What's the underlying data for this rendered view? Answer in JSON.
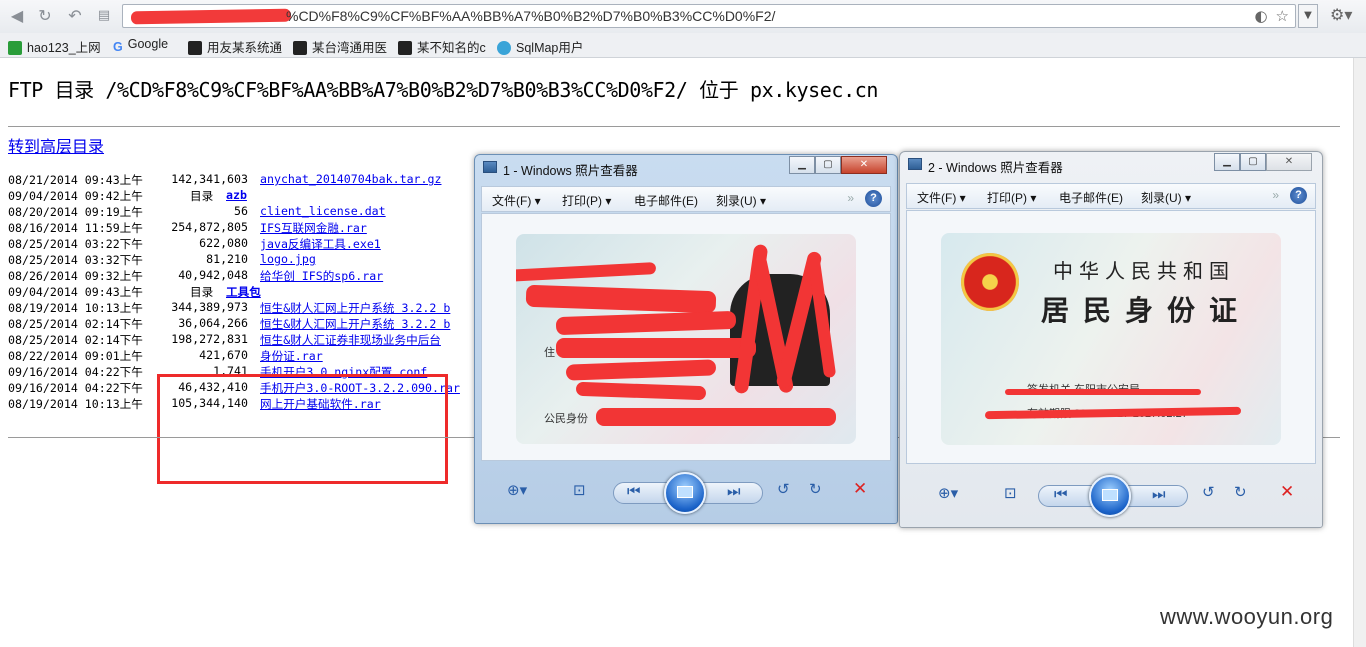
{
  "browser": {
    "address_tail": "%CD%F8%C9%CF%BF%AA%BB%A7%B0%B2%D7%B0%B3%CC%D0%F2/",
    "bookmarks": [
      {
        "label": "hao123_上网",
        "icon_color": "#2a9d3a"
      },
      {
        "label": "Google",
        "icon_color": "#4285f4"
      },
      {
        "label": "用友某系统通",
        "icon_color": "#222222"
      },
      {
        "label": "某台湾通用医",
        "icon_color": "#222222"
      },
      {
        "label": "某不知名的c",
        "icon_color": "#222222"
      },
      {
        "label": "SqlMap用户",
        "icon_color": "#3aa4d8"
      }
    ]
  },
  "page": {
    "heading": "FTP 目录 /%CD%F8%C9%CF%BF%AA%BB%A7%B0%B2%D7%B0%B3%CC%D0%F2/ 位于 px.kysec.cn",
    "up_link": "转到高层目录",
    "dir_label": "目录",
    "files": [
      {
        "date": "08/21/2014 09:43上午",
        "size": "142,341,603",
        "name": "anychat_20140704bak.tar.gz",
        "dir": false
      },
      {
        "date": "09/04/2014 09:42上午",
        "size": "",
        "name": "azb",
        "dir": true
      },
      {
        "date": "08/20/2014 09:19上午",
        "size": "56",
        "name": "client_license.dat",
        "dir": false
      },
      {
        "date": "08/16/2014 11:59上午",
        "size": "254,872,805",
        "name": "IFS互联网金融.rar",
        "dir": false
      },
      {
        "date": "08/25/2014 03:22下午",
        "size": "622,080",
        "name": "java反编译工具.exe1",
        "dir": false
      },
      {
        "date": "08/25/2014 03:32下午",
        "size": "81,210",
        "name": "logo.jpg",
        "dir": false
      },
      {
        "date": "08/26/2014 09:32上午",
        "size": "40,942,048",
        "name": "给华创 IFS的sp6.rar",
        "dir": false
      },
      {
        "date": "09/04/2014 09:43上午",
        "size": "",
        "name": "工具包",
        "dir": true
      },
      {
        "date": "08/19/2014 10:13上午",
        "size": "344,389,973",
        "name": "恒生&财人汇网上开户系统 3.2.2 b",
        "dir": false
      },
      {
        "date": "08/25/2014 02:14下午",
        "size": "36,064,266",
        "name": "恒生&财人汇网上开户系统 3.2.2 b",
        "dir": false
      },
      {
        "date": "08/25/2014 02:14下午",
        "size": "198,272,831",
        "name": "恒生&财人汇证券非现场业务中后台",
        "dir": false
      },
      {
        "date": "08/22/2014 09:01上午",
        "size": "421,670",
        "name": "身份证.rar",
        "dir": false
      },
      {
        "date": "09/16/2014 04:22下午",
        "size": "1,741",
        "name": "手机开户3.0 nginx配置.conf",
        "dir": false
      },
      {
        "date": "09/16/2014 04:22下午",
        "size": "46,432,410",
        "name": "手机开户3.0-ROOT-3.2.2.090.rar",
        "dir": false
      },
      {
        "date": "08/19/2014 10:13上午",
        "size": "105,344,140",
        "name": "网上开户基础软件.rar",
        "dir": false
      }
    ]
  },
  "viewer1": {
    "title": "1 - Windows 照片查看器",
    "menu": [
      "文件(F)",
      "打印(P)",
      "电子邮件(E)",
      "刻录(U)"
    ],
    "card_labels": {
      "name": "姓  名",
      "address": "住",
      "id": "公民身份"
    }
  },
  "viewer2": {
    "title": "2 - Windows 照片查看器",
    "menu": [
      "文件(F)",
      "打印(P)",
      "电子邮件(E)",
      "刻录(U)"
    ],
    "card_title1": "中华人民共和国",
    "card_title2": "居民身份证",
    "card_issuer": "签发机关  东阳市公安局",
    "card_valid": "有效期限  2007.02.27-2027.02.27"
  },
  "watermark": "www.wooyun.org"
}
